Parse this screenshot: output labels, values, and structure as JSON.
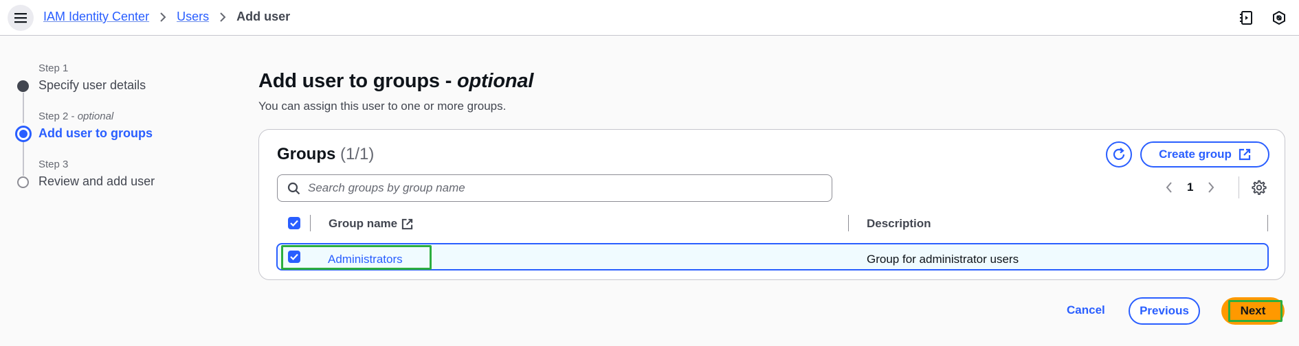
{
  "breadcrumb": {
    "items": [
      {
        "label": "IAM Identity Center"
      },
      {
        "label": "Users"
      }
    ],
    "current": "Add user"
  },
  "steps": [
    {
      "label": "Step 1",
      "optional": "",
      "title": "Specify user details",
      "state": "completed"
    },
    {
      "label": "Step 2 -",
      "optional": "optional",
      "title": "Add user to groups",
      "state": "active"
    },
    {
      "label": "Step 3",
      "optional": "",
      "title": "Review and add user",
      "state": "pending"
    }
  ],
  "main": {
    "title": "Add user to groups -",
    "title_optional": "optional",
    "description": "You can assign this user to one or more groups."
  },
  "groups_panel": {
    "title": "Groups",
    "count": "(1/1)",
    "create_label": "Create group",
    "search_placeholder": "Search groups by group name",
    "search_value": "",
    "page_number": "1",
    "columns": {
      "group_name": "Group name",
      "description": "Description"
    },
    "rows": [
      {
        "name": "Administrators",
        "description": "Group for administrator users",
        "selected": true
      }
    ],
    "select_all": true
  },
  "footer": {
    "cancel_label": "Cancel",
    "previous_label": "Previous",
    "next_label": "Next"
  },
  "colors": {
    "primary": "#295eff",
    "next_button": "#ff9900",
    "highlight": "#2cae3f"
  },
  "icons": [
    "menu-icon",
    "chevron-right-icon",
    "notes-icon",
    "settings-hex-icon",
    "refresh-icon",
    "external-link-icon",
    "search-icon",
    "chevron-left-icon",
    "gear-icon",
    "check-icon"
  ]
}
